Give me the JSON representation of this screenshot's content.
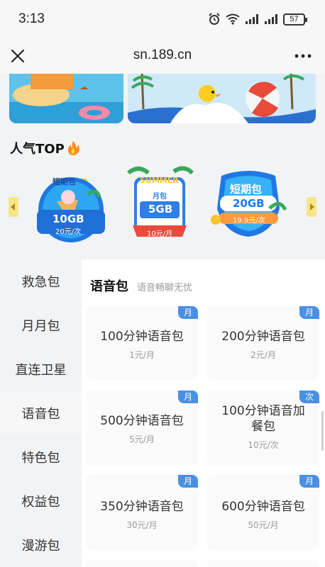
{
  "status_bar": {
    "time": "3:13",
    "battery": "57",
    "icons": [
      "alarm-icon",
      "wifi-icon",
      "signal-icon",
      "signal-icon",
      "battery-icon"
    ]
  },
  "browser": {
    "url": "sn.189.cn",
    "close_icon": "close-icon",
    "more_icon": "more-icon"
  },
  "popular": {
    "title": "人气TOP",
    "items": [
      {
        "tag": "短期包",
        "size": "10GB",
        "price": "20元/次"
      },
      {
        "tag": "月包",
        "banner": "SUMMER",
        "size": "5GB",
        "price": "10元/月"
      },
      {
        "tag": "短期包",
        "size": "20GB",
        "price": "19.9元/次"
      }
    ]
  },
  "sidebar": {
    "items": [
      {
        "label": "救急包"
      },
      {
        "label": "月月包"
      },
      {
        "label": "直连卫星"
      },
      {
        "label": "语音包",
        "active": true
      },
      {
        "label": "特色包"
      },
      {
        "label": "权益包"
      },
      {
        "label": "漫游包"
      }
    ]
  },
  "category": {
    "title": "语音包",
    "subtitle": "语音畅聊无忧",
    "cards": [
      {
        "badge": "月",
        "name": "100分钟语音包",
        "price": "1元/月"
      },
      {
        "badge": "月",
        "name": "200分钟语音包",
        "price": "2元/月"
      },
      {
        "badge": "月",
        "name": "500分钟语音包",
        "price": "5元/月"
      },
      {
        "badge": "次",
        "name": "100分钟语音加餐包",
        "price": "10元/次"
      },
      {
        "badge": "月",
        "name": "350分钟语音包",
        "price": "30元/月"
      },
      {
        "badge": "月",
        "name": "600分钟语音包",
        "price": "50元/月"
      }
    ]
  },
  "colors": {
    "badge": "#4a90e2",
    "arrow": "#f8e58a",
    "background": "#f2f3f5"
  }
}
